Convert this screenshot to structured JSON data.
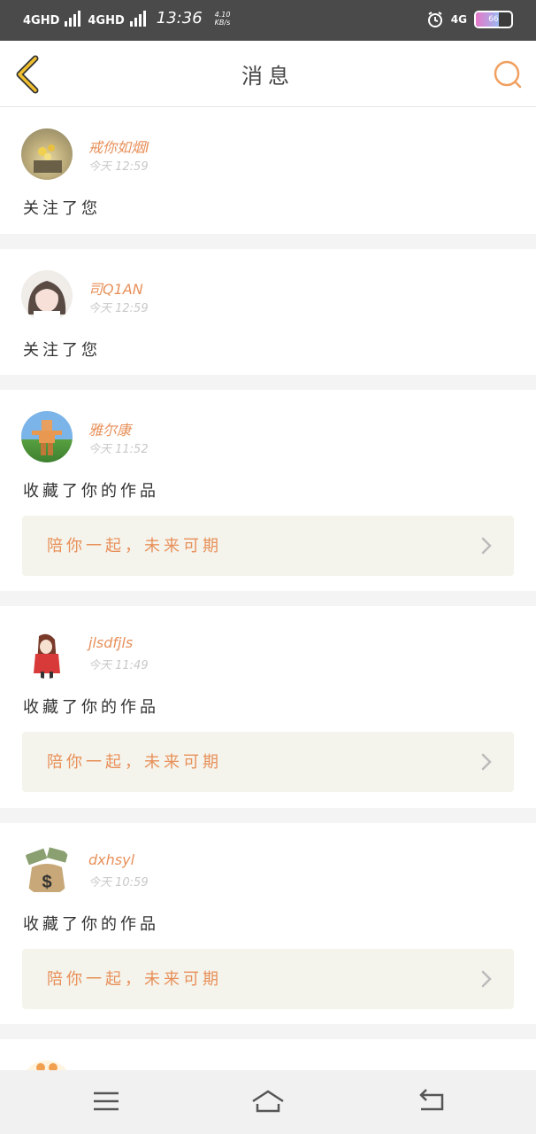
{
  "statusbar": {
    "sim1": "4GHD",
    "sim2": "4GHD",
    "time": "13:36",
    "speed_value": "4.10",
    "speed_unit": "KB/s",
    "net": "4G",
    "battery_percent": "66",
    "icons": [
      "signal-icon",
      "alarm-icon",
      "battery-icon"
    ]
  },
  "header": {
    "title": "消息",
    "back_icon": "back-chevron-icon",
    "search_icon": "search-icon",
    "accent_color": "#e8a030"
  },
  "messages": [
    {
      "username": "戒你如烟l",
      "time": "今天 12:59",
      "action": "关注了您"
    },
    {
      "username": "司Q1AN",
      "time": "今天 12:59",
      "action": "关注了您"
    },
    {
      "username": "雅尔康",
      "time": "今天 11:52",
      "action": "收藏了你的作品",
      "work": "陪你一起，未来可期"
    },
    {
      "username": "jlsdfjls",
      "time": "今天 11:49",
      "action": "收藏了你的作品",
      "work": "陪你一起，未来可期"
    },
    {
      "username": "dxhsyl",
      "time": "今天 10:59",
      "action": "收藏了你的作品",
      "work": "陪你一起，未来可期"
    }
  ],
  "colors": {
    "username": "#e8905a",
    "work_bg": "#f4f4ec",
    "page_bg": "#f4f4f4"
  },
  "navbar": {
    "icons": [
      "menu-icon",
      "home-icon",
      "back-icon"
    ]
  }
}
